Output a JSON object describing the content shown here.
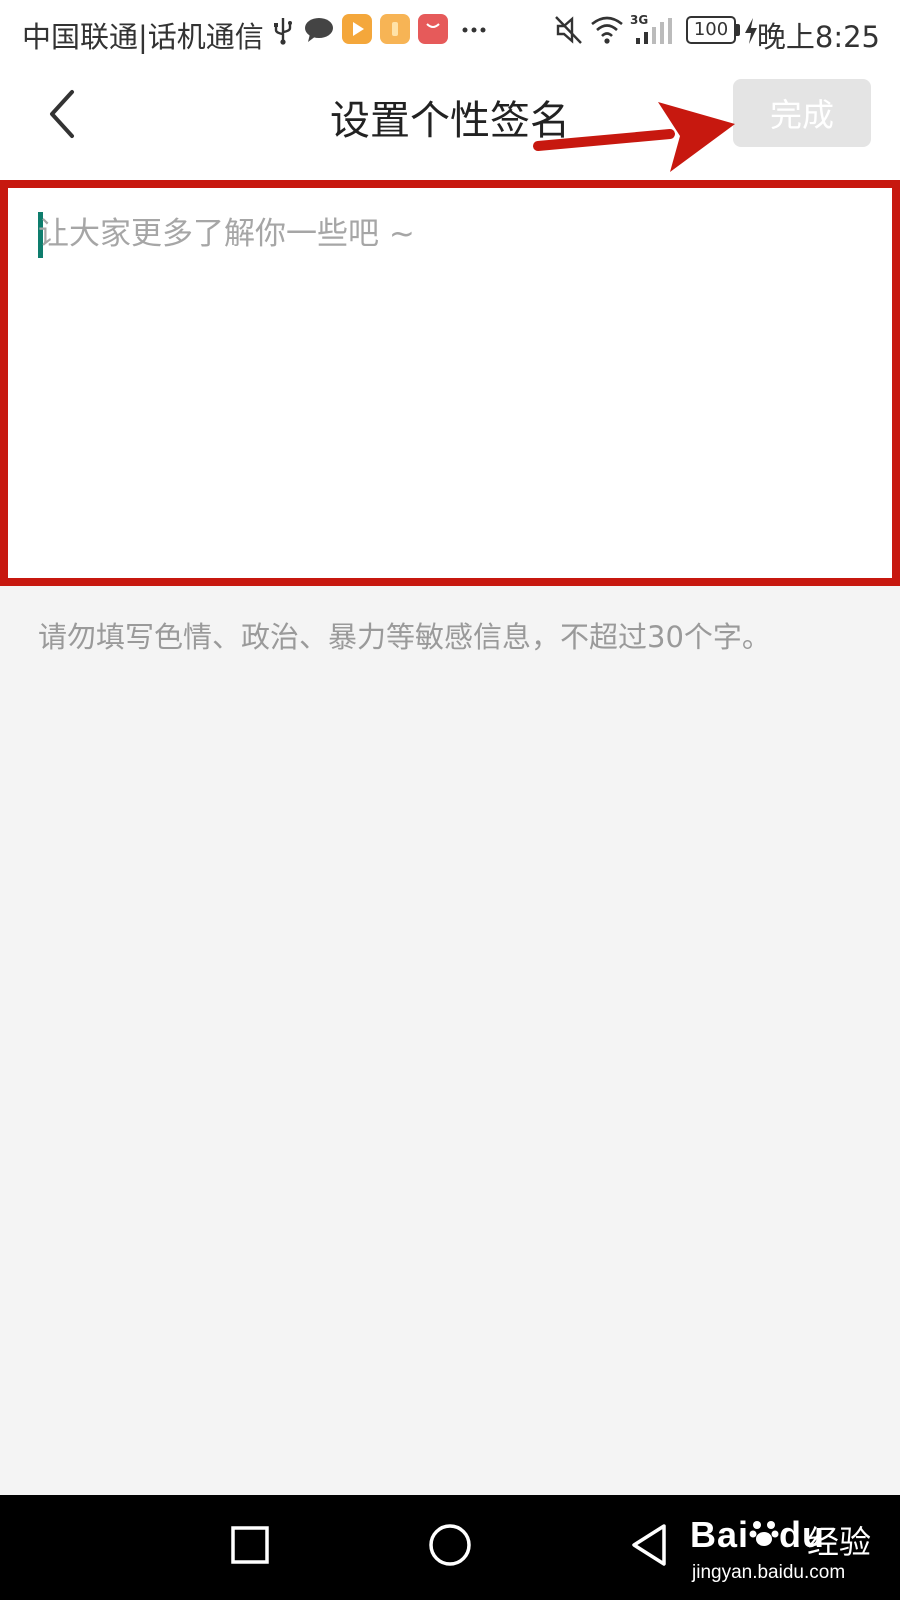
{
  "status_bar": {
    "carrier": "中国联通|话机通信",
    "battery": "100",
    "network": "3G",
    "time": "晚上8:25",
    "icons": [
      "usb-icon",
      "chat-bubble-icon",
      "video-app-icon",
      "orange-app-icon",
      "huawei-app-icon",
      "more-dots-icon",
      "mute-icon",
      "wifi-icon",
      "signal-icon",
      "battery-icon",
      "charging-icon"
    ]
  },
  "header": {
    "title": "设置个性签名",
    "done_label": "完成"
  },
  "signature_input": {
    "placeholder": "让大家更多了解你一些吧 ~",
    "value": ""
  },
  "hint": "请勿填写色情、政治、暴力等敏感信息，不超过30个字。",
  "watermark": {
    "brand": "Bai",
    "brand_suffix": "du",
    "cn": "经验",
    "url": "jingyan.baidu.com"
  },
  "colors": {
    "annotation_red": "#c7180f",
    "caret_teal": "#0e7d6d",
    "page_bg": "#f4f4f4",
    "done_bg": "#e4e4e4"
  }
}
